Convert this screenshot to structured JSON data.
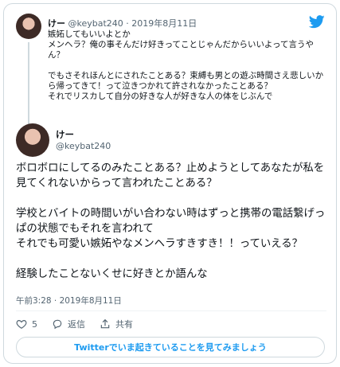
{
  "parent_tweet": {
    "author_name": "けー",
    "author_handle": "@keybat240",
    "separator": "·",
    "date": "2019年8月11日",
    "text": "嫉妬してもいいよとか\nメンヘラ？俺の事そんだけ好きってことじゃんだからいいよって言うやん？\n\nでもさそれほんとにされたことある？束縛も男との遊ぶ時間さえ悲しいから帰ってきて！って泣きつかれて許されなかったことある？\nそれでリスカして自分の好きな人が好きな人の体をじぶんで"
  },
  "main_tweet": {
    "author_name": "けー",
    "author_handle": "@keybat240",
    "text": "ボロボロにしてるのみたことある？止めようとしてあなたが私を見てくれないからって言われたことある？\n\n学校とバイトの時間いがい合わない時はずっと携帯の電話繋げっぱの状態でもそれを言われて\nそれでも可愛い嫉妬やなメンヘラすきすき！！っていえる？\n\n経験したことないくせに好きとか語んな",
    "timestamp": "午前3:28 · 2019年8月11日"
  },
  "actions": {
    "like_count": "5",
    "reply_label": "返信",
    "share_label": "共有"
  },
  "cta": {
    "label": "Twitterでいま起きていることを見てみましょう"
  },
  "icons": {
    "logo": "twitter-bird-icon",
    "like": "heart-icon",
    "reply": "reply-bubble-icon",
    "share": "share-icon"
  },
  "colors": {
    "brand": "#1d9bf0",
    "secondary_text": "#536471",
    "border": "#cfd9de"
  }
}
